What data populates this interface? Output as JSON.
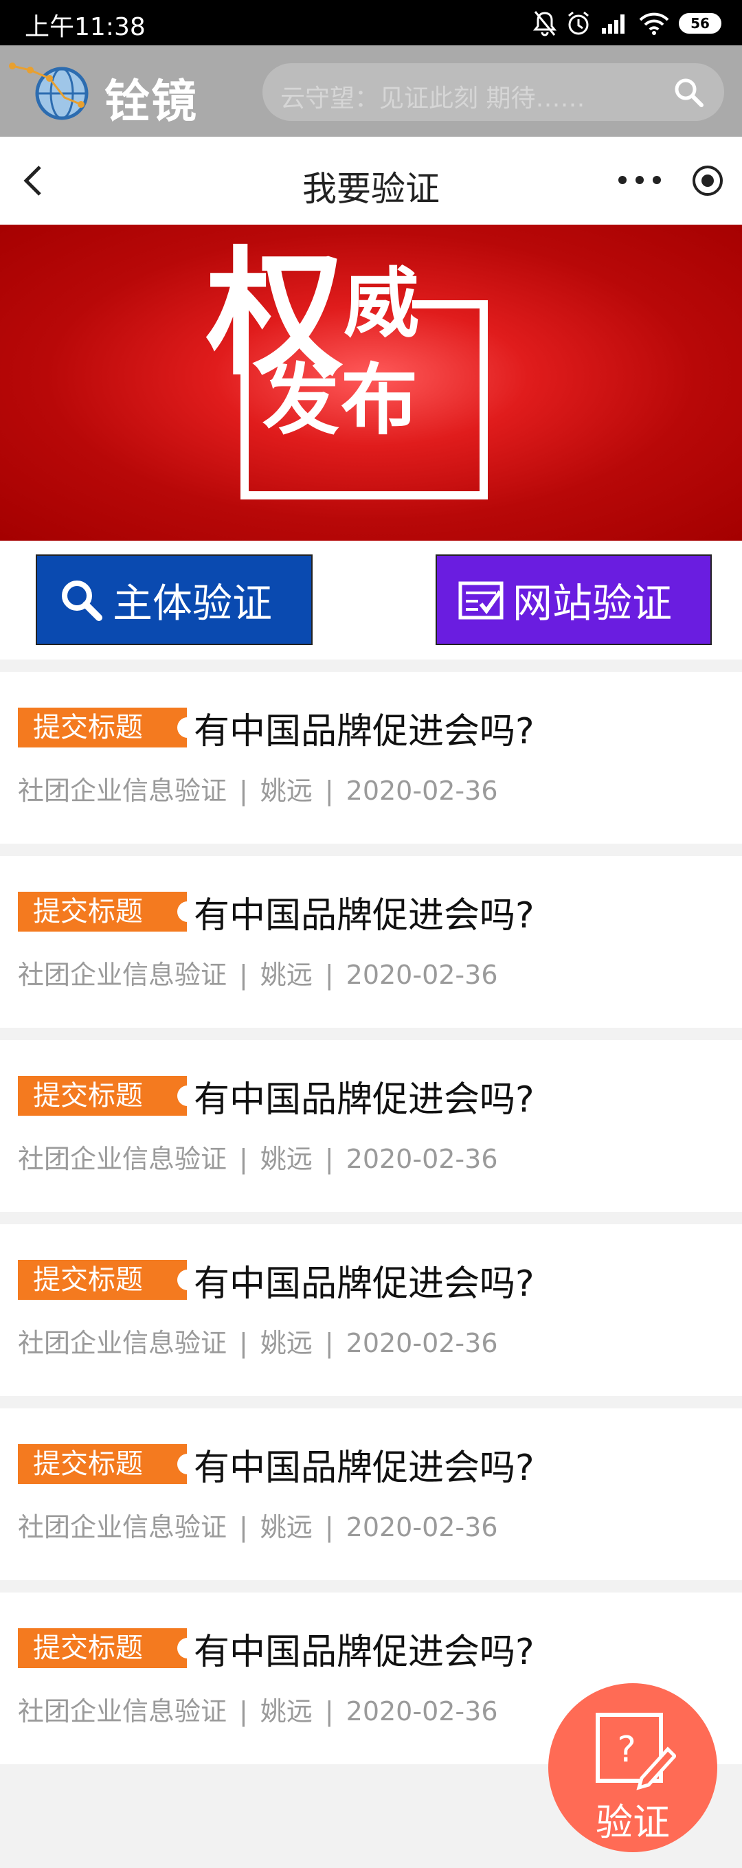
{
  "status_bar": {
    "time": "上午11:38",
    "battery": "56"
  },
  "header": {
    "brand": "铨镜",
    "search_placeholder": "云守望：见证此刻 期待……"
  },
  "nav": {
    "title": "我要验证"
  },
  "banner": {
    "quan": "权",
    "wei": "威",
    "fabu": "发布"
  },
  "buttons": {
    "entity": "主体验证",
    "site": "网站验证"
  },
  "list": [
    {
      "tag": "提交标题",
      "title": "有中国品牌促进会吗?",
      "category": "社团企业信息验证",
      "author": "姚远",
      "date": "2020-02-36",
      "sep1": "|",
      "sep2": "|"
    },
    {
      "tag": "提交标题",
      "title": "有中国品牌促进会吗?",
      "category": "社团企业信息验证",
      "author": "姚远",
      "date": "2020-02-36",
      "sep1": "|",
      "sep2": "|"
    },
    {
      "tag": "提交标题",
      "title": "有中国品牌促进会吗?",
      "category": "社团企业信息验证",
      "author": "姚远",
      "date": "2020-02-36",
      "sep1": "|",
      "sep2": "|"
    },
    {
      "tag": "提交标题",
      "title": "有中国品牌促进会吗?",
      "category": "社团企业信息验证",
      "author": "姚远",
      "date": "2020-02-36",
      "sep1": "|",
      "sep2": "|"
    },
    {
      "tag": "提交标题",
      "title": "有中国品牌促进会吗?",
      "category": "社团企业信息验证",
      "author": "姚远",
      "date": "2020-02-36",
      "sep1": "|",
      "sep2": "|"
    },
    {
      "tag": "提交标题",
      "title": "有中国品牌促进会吗?",
      "category": "社团企业信息验证",
      "author": "姚远",
      "date": "2020-02-36",
      "sep1": "|",
      "sep2": "|"
    }
  ],
  "fab": {
    "label": "验证",
    "glyph": "?"
  },
  "colors": {
    "tag": "#f47a1f",
    "entity_button": "#0a4ab0",
    "site_button": "#6a1de0",
    "fab": "#ff6b55",
    "banner_red": "#b80808"
  },
  "icons": [
    "mute-icon",
    "alarm-icon",
    "signal-icon",
    "wifi-icon",
    "battery-icon",
    "logo-globe-icon",
    "search-icon",
    "back-icon",
    "more-icon",
    "target-icon",
    "magnifier-icon",
    "checklist-icon",
    "note-pencil-icon"
  ]
}
